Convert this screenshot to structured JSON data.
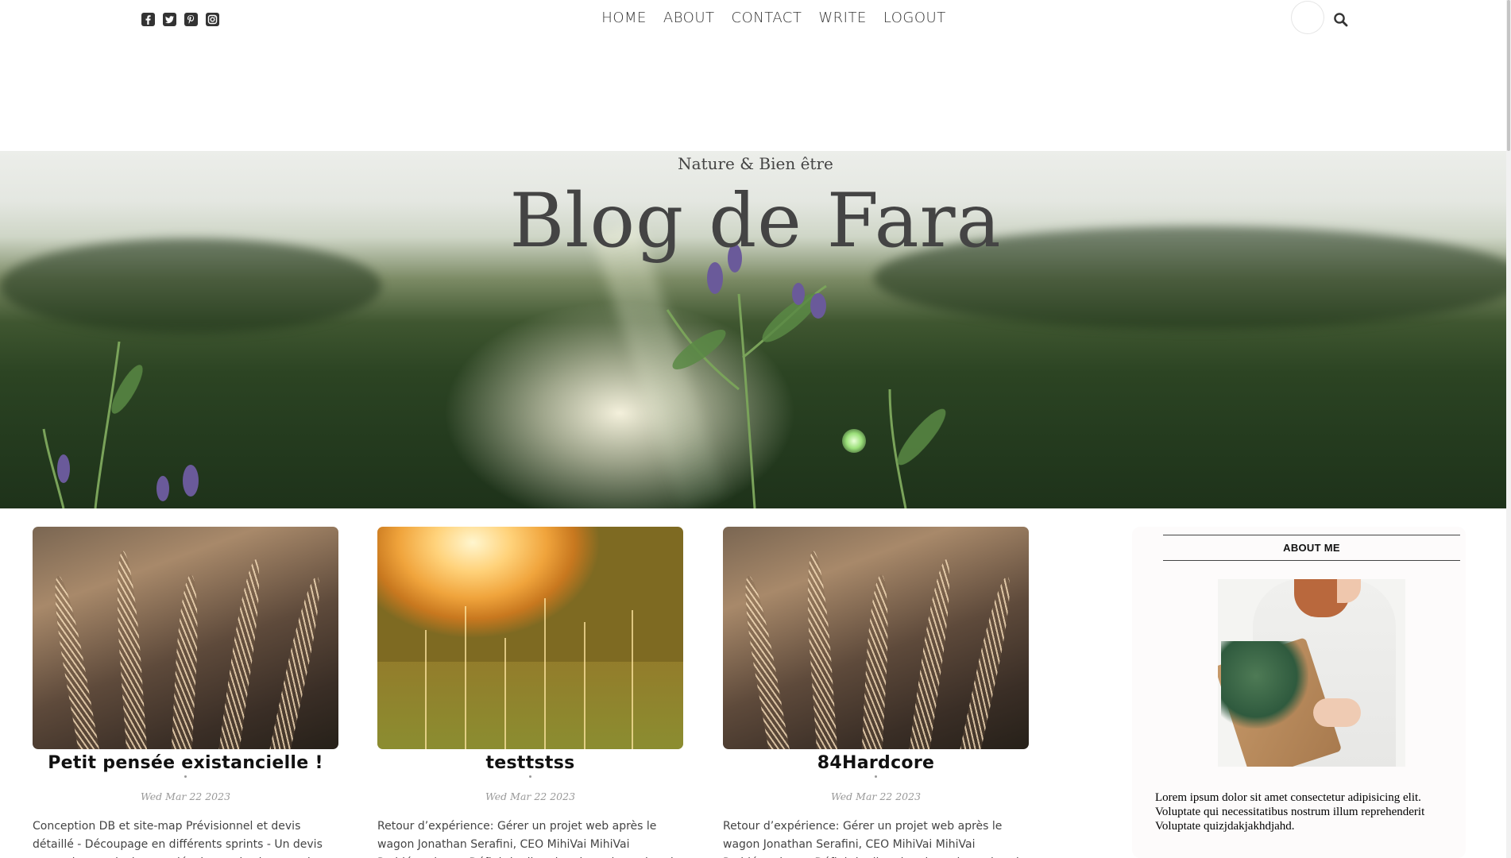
{
  "social": {
    "icons": [
      "facebook-square-icon",
      "twitter-square-icon",
      "pinterest-square-icon",
      "instagram-icon"
    ]
  },
  "nav": {
    "items": [
      "HOME",
      "ABOUT",
      "CONTACT",
      "WRITE",
      "LOGOUT"
    ]
  },
  "header": {
    "subtitle": "Nature & Bien être",
    "title": "Blog de Fara"
  },
  "posts": [
    {
      "title": "Petit pensée existancielle !",
      "date": "Wed Mar 22 2023",
      "desc": "Conception DB et site-map Prévisionnel et devis détaillé - Découpage en différents sprints - Un devis par sprint, un devis pour développer le site complet et fonctionnel"
    },
    {
      "title": "testtstss",
      "date": "Wed Mar 22 2023",
      "desc": "Retour d’expérience: Gérer un projet web après le wagon Jonathan Serafini, CEO MihiVai MihiVai Problématique - Définir la direction du projet web et le Solution"
    },
    {
      "title": "84Hardcore",
      "date": "Wed Mar 22 2023",
      "desc": "Retour d’expérience: Gérer un projet web après le wagon Jonathan Serafini, CEO MihiVai MihiVai Problématique - Définir la direction du projet web et le Solution"
    }
  ],
  "sidebar": {
    "heading": "ABOUT ME",
    "text": "Lorem ipsum dolor sit amet consectetur adipisicing elit. Voluptate qui necessitatibus nostrum illum reprehenderit Voluptate quizjdakjakhdjahd."
  },
  "colors": {
    "text_dark": "#333333",
    "sidebar_bg": "#fdfbfb",
    "date_grey": "#999999"
  }
}
